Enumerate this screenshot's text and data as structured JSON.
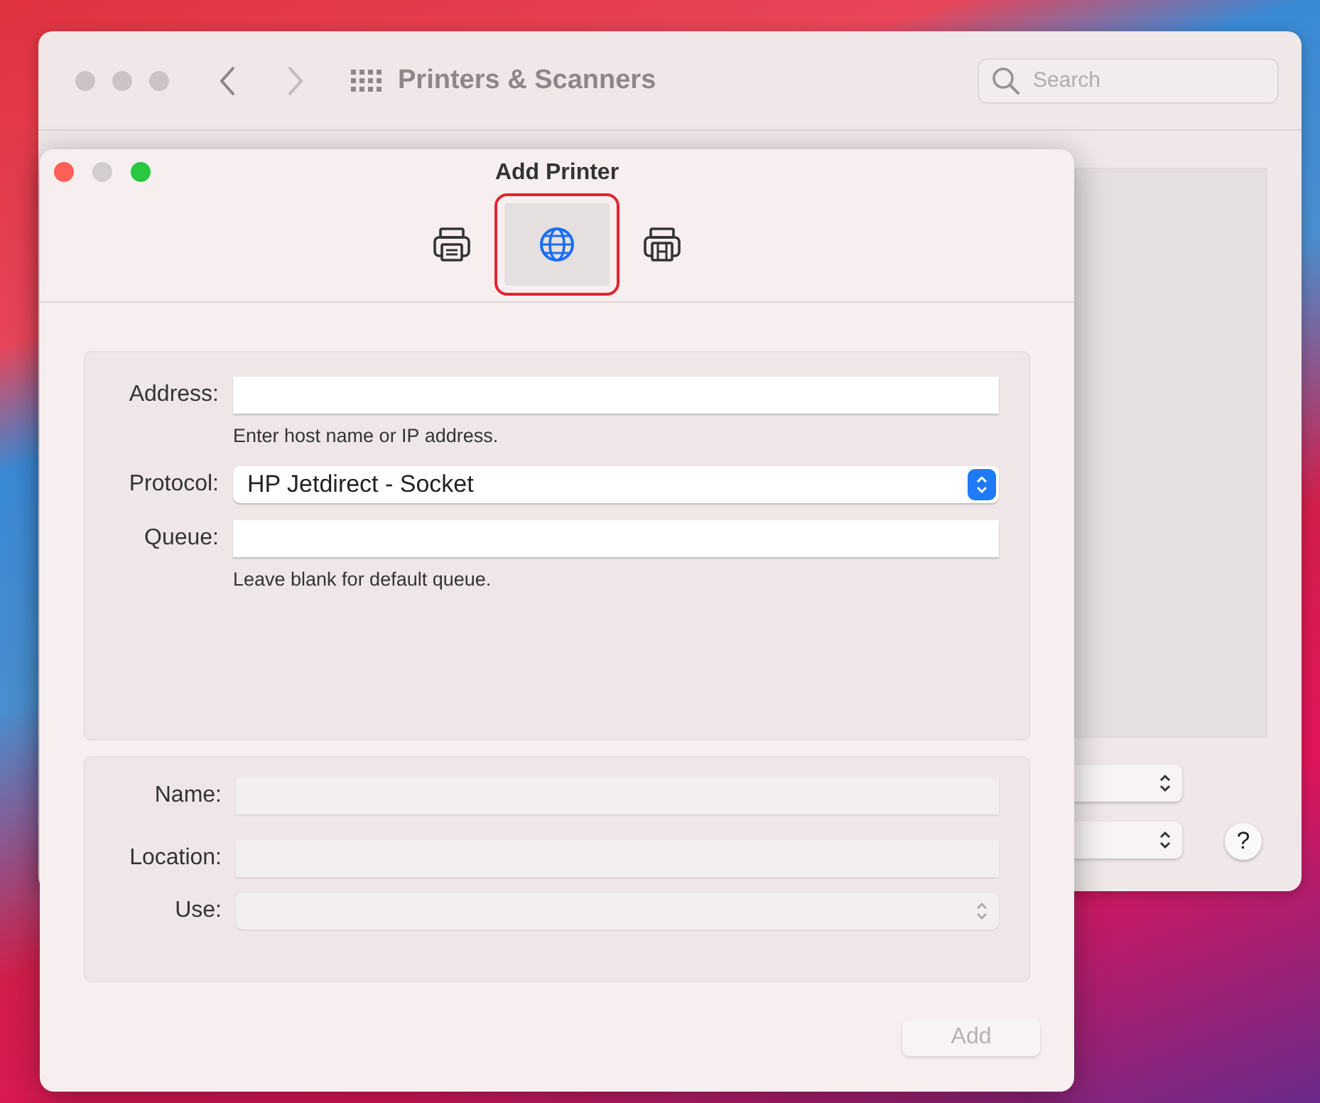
{
  "background_window": {
    "active": false,
    "title": "Printers & Scanners",
    "search": {
      "placeholder": "Search"
    },
    "help_button": "?"
  },
  "dialog": {
    "active": true,
    "title": "Add Printer",
    "toolbar": [
      {
        "kind": "printer",
        "selected": false,
        "highlighted": false
      },
      {
        "kind": "globe",
        "selected": true,
        "highlighted": true
      },
      {
        "kind": "windows-printer",
        "selected": false,
        "highlighted": false
      }
    ],
    "connection_fields": [
      {
        "kind": "text",
        "label": "Address:",
        "hint": "Enter host name or IP address.",
        "disabled": false
      },
      {
        "kind": "popup",
        "label": "Protocol:",
        "value": "HP Jetdirect - Socket",
        "disabled": false
      },
      {
        "kind": "text",
        "label": "Queue:",
        "hint": "Leave blank for default queue.",
        "disabled": false
      }
    ],
    "printer_fields": [
      {
        "kind": "text",
        "label": "Name:",
        "disabled": true
      },
      {
        "kind": "text",
        "label": "Location:",
        "disabled": true
      },
      {
        "kind": "popup",
        "label": "Use:",
        "disabled": true
      }
    ],
    "add_button": {
      "label": "Add",
      "disabled": true
    }
  }
}
